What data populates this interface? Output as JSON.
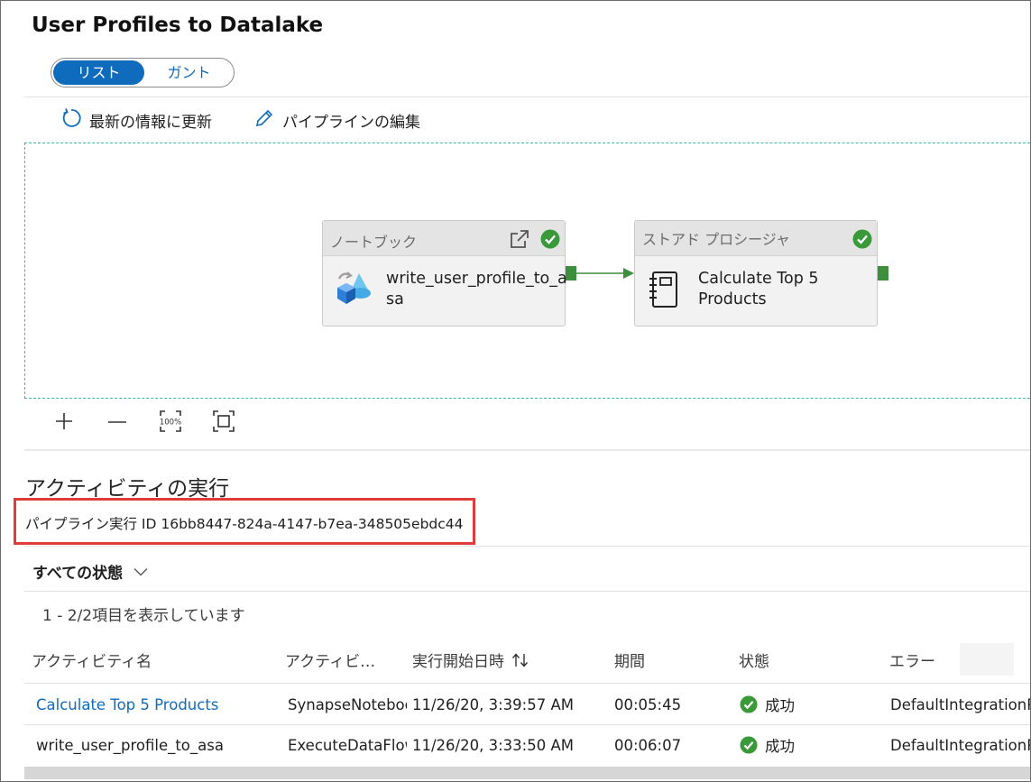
{
  "header": {
    "title": "User Profiles to Datalake"
  },
  "view_toggle": {
    "list_label": "リスト",
    "gantt_label": "ガント"
  },
  "toolbar": {
    "refresh_label": "最新の情報に更新",
    "edit_label": "パイプラインの編集"
  },
  "pipeline": {
    "activities": [
      {
        "type": "ノートブック",
        "name_line1": "write_user_profile_to_a",
        "name_line2": "sa",
        "status": "succeeded"
      },
      {
        "type": "ストアド プロシージャ",
        "name_line1": "Calculate Top 5",
        "name_line2": "Products",
        "status": "succeeded"
      }
    ]
  },
  "zoom_controls": {
    "zoom100_label": "100%"
  },
  "activity_runs": {
    "section_title": "アクティビティの実行",
    "run_id_label": "パイプライン実行 ID",
    "run_id_value": "16bb8447-824a-4147-b7ea-348505ebdc44",
    "status_filter": "すべての状態",
    "result_count": "1 - 2/2項目を表示しています",
    "columns": [
      "アクティビティ名",
      "アクティビ…",
      "実行開始日時",
      "期間",
      "状態",
      "エラー"
    ],
    "sort_icon": "sort-up-down-icon",
    "rows": [
      {
        "name": "Calculate Top 5 Products",
        "activity_type": "SynapseNotebook",
        "start": "11/26/20, 3:39:57 AM",
        "duration": "00:05:45",
        "status": "成功",
        "integration_runtime": "DefaultIntegrationRuntime"
      },
      {
        "name": "write_user_profile_to_asa",
        "activity_type": "ExecuteDataFlow",
        "start": "11/26/20, 3:33:50 AM",
        "duration": "00:06:07",
        "status": "成功",
        "integration_runtime": "DefaultIntegrationRuntime"
      }
    ]
  },
  "colors": {
    "accent": "#0f6cbd",
    "success": "#3a9a3a",
    "highlight_box": "#e03c3c",
    "canvas_border": "#37b9b0"
  }
}
